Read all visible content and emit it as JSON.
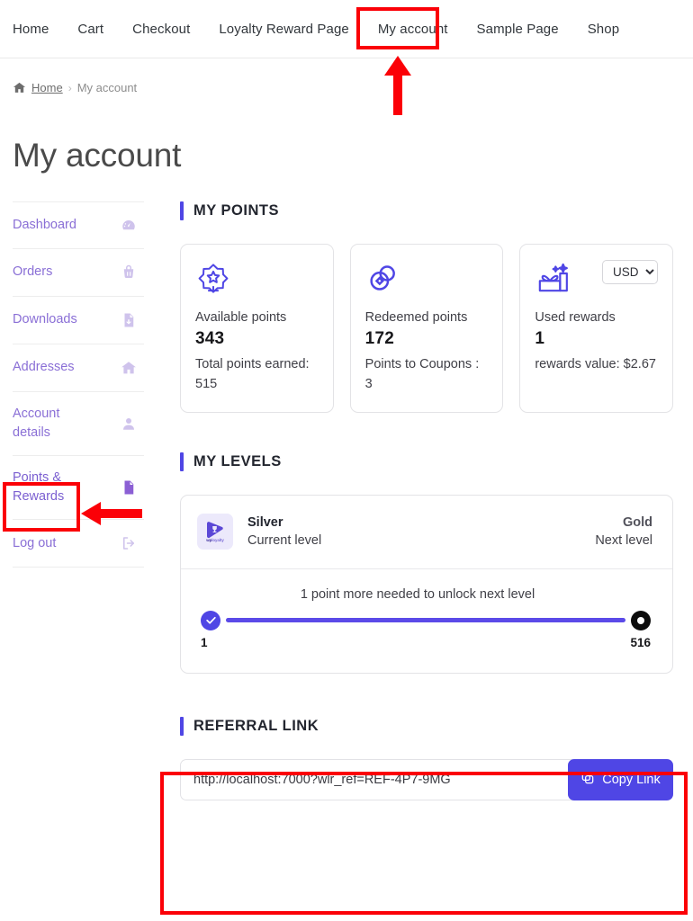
{
  "nav": {
    "items": [
      {
        "label": "Home"
      },
      {
        "label": "Cart"
      },
      {
        "label": "Checkout"
      },
      {
        "label": "Loyalty Reward Page"
      },
      {
        "label": "My account"
      },
      {
        "label": "Sample Page"
      },
      {
        "label": "Shop"
      }
    ]
  },
  "breadcrumb": {
    "home_label": "Home",
    "separator": "›",
    "current": "My account"
  },
  "page_title": "My account",
  "sidebar": {
    "items": [
      {
        "label": "Dashboard",
        "icon": "dashboard-icon",
        "active": false
      },
      {
        "label": "Orders",
        "icon": "basket-icon",
        "active": false
      },
      {
        "label": "Downloads",
        "icon": "download-file-icon",
        "active": false
      },
      {
        "label": "Addresses",
        "icon": "home-icon",
        "active": false
      },
      {
        "label": "Account details",
        "icon": "user-icon",
        "active": false
      },
      {
        "label": "Points & Rewards",
        "icon": "document-icon",
        "active": true
      },
      {
        "label": "Log out",
        "icon": "logout-icon",
        "active": false
      }
    ]
  },
  "my_points": {
    "section_title": "MY POINTS",
    "cards": [
      {
        "icon": "star-badge-icon",
        "label": "Available points",
        "value": "343",
        "sub": "Total points earned: 515"
      },
      {
        "icon": "coins-icon",
        "label": "Redeemed points",
        "value": "172",
        "sub": "Points to Coupons : 3"
      },
      {
        "icon": "gift-icon",
        "label": "Used rewards",
        "value": "1",
        "sub": "rewards value: $2.67"
      }
    ],
    "currency": {
      "selected": "USD",
      "options": [
        "USD"
      ]
    }
  },
  "my_levels": {
    "section_title": "MY LEVELS",
    "brand": {
      "wp": "wp",
      "loyalty": "loyalty"
    },
    "current": {
      "name": "Silver",
      "caption": "Current level"
    },
    "next": {
      "name": "Gold",
      "caption": "Next level"
    },
    "progress_message": "1 point more needed to unlock next level",
    "start_label": "1",
    "end_label": "516",
    "progress_percent": 100
  },
  "referral": {
    "section_title": "REFERRAL LINK",
    "link_value": "http://localhost:7000?wlr_ref=REF-4P7-9MG",
    "link_placeholder": "Referral link",
    "copy_label": "Copy Link",
    "copy_icon": "copy-icon"
  },
  "colors": {
    "accent": "#4f46e5",
    "sidebar_link": "#8a6fd6",
    "annotation": "#fb0007",
    "progress_track": "#5b4ae8"
  }
}
